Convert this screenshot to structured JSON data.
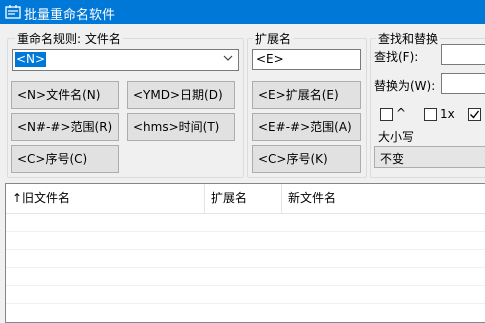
{
  "window": {
    "title": "批量重命名软件",
    "accent": "#0078d7"
  },
  "rule_group": {
    "label": "重命名规则: 文件名",
    "rule_value": "<N>",
    "buttons": {
      "name": "<N>文件名(N)",
      "date": "<YMD>日期(D)",
      "range": "<N#-#>范围(R)",
      "time": "<hms>时间(T)",
      "counter": "<C>序号(C)"
    }
  },
  "ext_group": {
    "label": "扩展名",
    "ext_value": "<E>",
    "buttons": {
      "ext": "<E>扩展名(E)",
      "range": "<E#-#>范围(A)",
      "counter": "<C>序号(K)"
    }
  },
  "find_group": {
    "label": "查找和替换",
    "find_label": "查找(F):",
    "find_value": "",
    "replace_label": "替换为(W):",
    "replace_value": "",
    "options": [
      {
        "label": "^",
        "checked": false
      },
      {
        "label": "1x",
        "checked": false
      },
      {
        "label": "",
        "checked": true
      }
    ],
    "case_label": "大小写",
    "case_value": "不变"
  },
  "file_list": {
    "columns": [
      "↑旧文件名",
      "扩展名",
      "新文件名"
    ]
  }
}
